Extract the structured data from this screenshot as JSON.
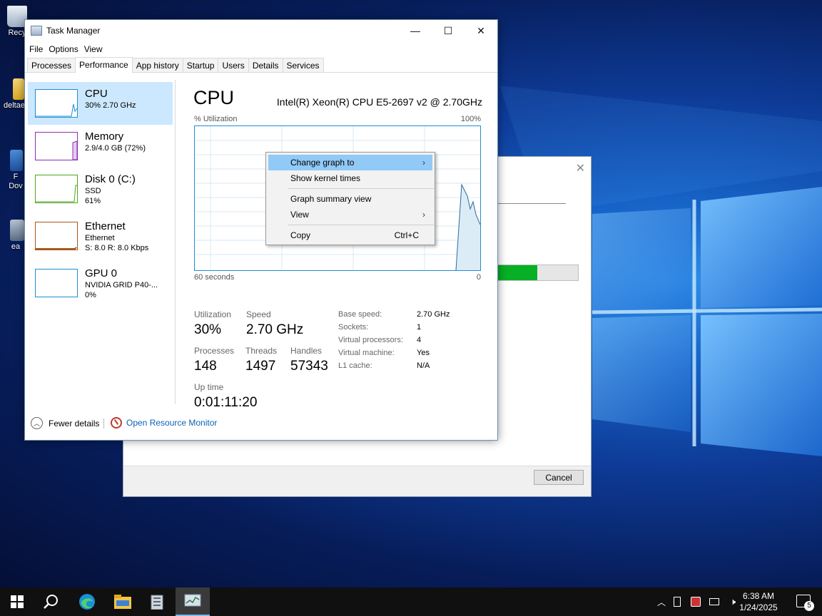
{
  "desktop": {
    "icons": [
      {
        "label": "Recy",
        "name": "recycle-bin"
      },
      {
        "label": "deltae",
        "name": "folder"
      },
      {
        "label": "F\nDov",
        "name": "shortcut"
      },
      {
        "label": "ea",
        "name": "shortcut2"
      }
    ]
  },
  "bg_dialog": {
    "cancel_label": "Cancel",
    "progress_percent": 52
  },
  "window": {
    "title": "Task Manager",
    "controls": {
      "minimize": "—",
      "maximize": "☐",
      "close": "✕"
    }
  },
  "menu": [
    "File",
    "Options",
    "View"
  ],
  "tabs": [
    "Processes",
    "Performance",
    "App history",
    "Startup",
    "Users",
    "Details",
    "Services"
  ],
  "active_tab": "Performance",
  "sidebar": [
    {
      "title": "CPU",
      "line1": "30% 2.70 GHz",
      "line2": "",
      "color": "#1e8fcf",
      "active": true
    },
    {
      "title": "Memory",
      "line1": "2.9/4.0 GB (72%)",
      "line2": "",
      "color": "#8b2fb3",
      "active": false
    },
    {
      "title": "Disk 0 (C:)",
      "line1": "SSD",
      "line2": "61%",
      "color": "#4da51f",
      "active": false
    },
    {
      "title": "Ethernet",
      "line1": "Ethernet",
      "line2": "S: 8.0  R: 8.0 Kbps",
      "color": "#a8561c",
      "active": false
    },
    {
      "title": "GPU 0",
      "line1": "NVIDIA GRID P40-...",
      "line2": "0%",
      "color": "#1e8fcf",
      "active": false
    }
  ],
  "main": {
    "heading": "CPU",
    "cpu_name": "Intel(R) Xeon(R) CPU E5-2697 v2 @ 2.70GHz",
    "util_label": "% Utilization",
    "util_max": "100%",
    "time_label": "60 seconds",
    "time_min": "0",
    "stats": {
      "utilization": {
        "label": "Utilization",
        "value": "30%"
      },
      "speed": {
        "label": "Speed",
        "value": "2.70 GHz"
      },
      "processes": {
        "label": "Processes",
        "value": "148"
      },
      "threads": {
        "label": "Threads",
        "value": "1497"
      },
      "handles": {
        "label": "Handles",
        "value": "57343"
      },
      "uptime": {
        "label": "Up time",
        "value": "0:01:11:20"
      }
    },
    "details": [
      {
        "k": "Base speed:",
        "v": "2.70 GHz"
      },
      {
        "k": "Sockets:",
        "v": "1"
      },
      {
        "k": "Virtual processors:",
        "v": "4"
      },
      {
        "k": "Virtual machine:",
        "v": "Yes"
      },
      {
        "k": "L1 cache:",
        "v": "N/A"
      }
    ]
  },
  "context_menu": {
    "items": [
      {
        "label": "Change graph to",
        "arrow": "›",
        "highlight": true
      },
      {
        "label": "Show kernel times"
      },
      {
        "label": "Graph summary view"
      },
      {
        "label": "View",
        "arrow": "›"
      },
      {
        "label": "Copy",
        "shortcut": "Ctrl+C"
      }
    ]
  },
  "footer": {
    "fewer_details": "Fewer details",
    "open_resource_monitor": "Open Resource Monitor"
  },
  "taskbar": {
    "time": "6:38 AM",
    "date": "1/24/2025",
    "notification_count": "5"
  }
}
